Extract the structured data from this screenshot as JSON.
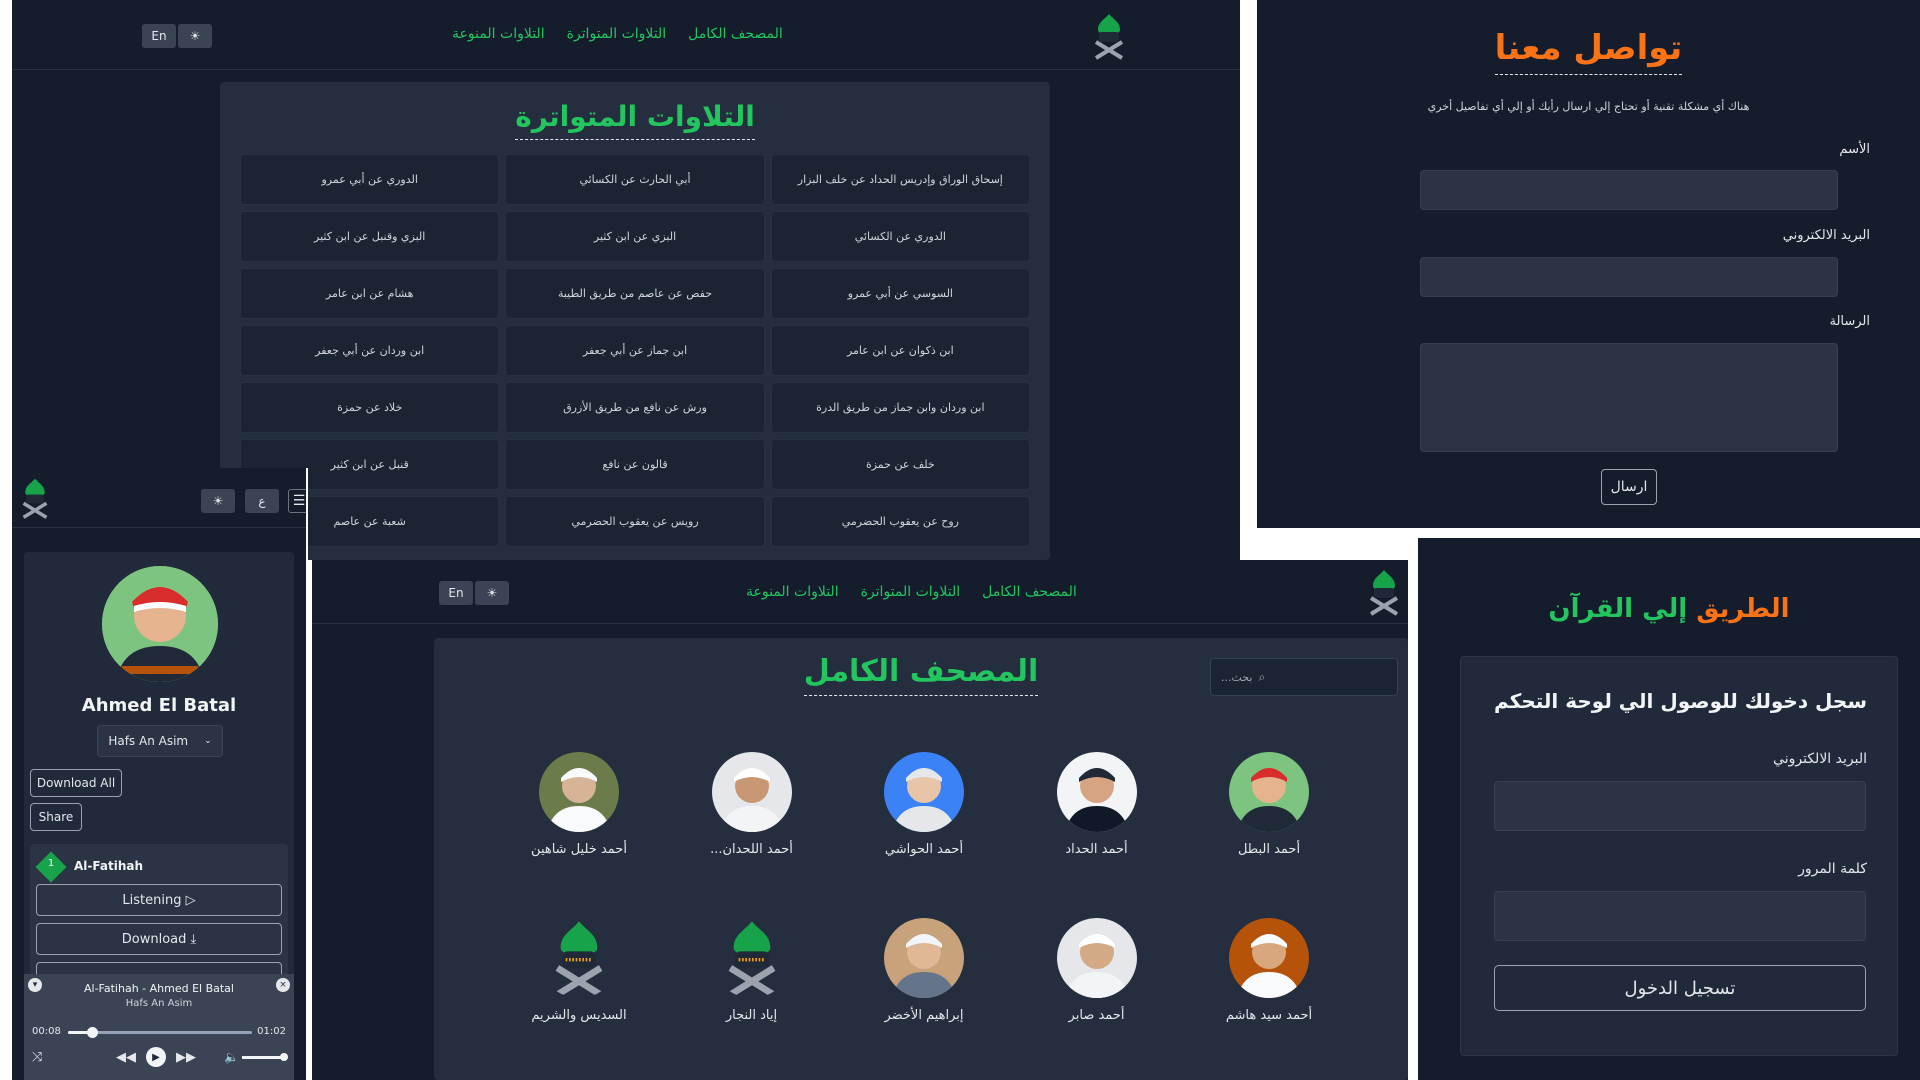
{
  "top_panel": {
    "nav": {
      "link1": "المصحف الكامل",
      "link2": "التلاوات المتواترة",
      "link3": "التلاوات المنوعة"
    },
    "lang_button": "En",
    "title": "التلاوات المتواترة",
    "grid": [
      [
        "إسحاق الوراق وإدريس الحداد عن خلف البزار",
        "أبي الحارث عن الكسائي",
        "الدوري عن أبي عمرو"
      ],
      [
        "الدوري عن الكسائي",
        "البزي عن ابن كثير",
        "البزي وقنبل عن ابن كثير"
      ],
      [
        "السوسي عن أبي عمرو",
        "حفص عن عاصم من طريق الطيبة",
        "هشام عن ابن عامر"
      ],
      [
        "ابن ذكوان عن ابن عامر",
        "ابن جماز عن أبي جعفر",
        "ابن وردان عن أبي جعفر"
      ],
      [
        "ابن وردان وابن جماز من طريق الدرة",
        "ورش عن نافع من طريق الأزرق",
        "خلاد عن حمزة"
      ],
      [
        "خلف عن حمزة",
        "قالون عن نافع",
        "قنبل عن ابن كثير"
      ],
      [
        "روح عن يعقوب الحضرمي",
        "رويس عن يعقوب الحضرمي",
        "شعبة عن عاصم"
      ]
    ]
  },
  "contact": {
    "title": "تواصل معنا",
    "subtitle": "هناك أي مشكلة تقنية أو تحتاج إلي ارسال رأيك أو إلي أي تفاصيل أخري",
    "name_label": "الأسم",
    "email_label": "البريد الالكتروني",
    "message_label": "الرسالة",
    "send": "ارسال"
  },
  "mobile": {
    "lang_button": "ع",
    "reciter_name": "Ahmed El Batal",
    "riwaya": "Hafs An Asim",
    "download_all": "Download All",
    "share": "Share",
    "surah_number": "1",
    "surah_name": "Al-Fatihah",
    "listening": "Listening ▷",
    "download": "Download ⤓",
    "player": {
      "title": "Al-Fatihah - Ahmed El Batal",
      "subtitle": "Hafs An Asim",
      "current": "00:08",
      "total": "01:02",
      "progress": 0.13,
      "volume": 1.0
    }
  },
  "mushaf": {
    "nav": {
      "link1": "المصحف الكامل",
      "link2": "التلاوات المتواترة",
      "link3": "التلاوات المنوعة"
    },
    "lang_button": "En",
    "title": "المصحف الكامل",
    "search_placeholder": "بحث...",
    "reciters_row1": [
      "أحمد البطل",
      "أحمد الحداد",
      "أحمد الحواشي",
      "أحمد اللحدان...",
      "أحمد خليل شاهين"
    ],
    "reciters_row2": [
      "أحمد سيد هاشم",
      "أحمد صابر",
      "إبراهيم الأخضر",
      "إياد النجار",
      "السديس والشريم"
    ]
  },
  "login": {
    "brand_part1": "الطريق",
    "brand_part2": "إلي القرآن",
    "heading": "سجل دخولك للوصول الي لوحة التحكم",
    "email_label": "البريد الالكتروني",
    "password_label": "كلمة المرور",
    "submit": "تسجيل الدخول"
  },
  "colors": {
    "bg": "#151d2c",
    "card": "#212a3a",
    "green": "#22c55e",
    "orange": "#f97316"
  }
}
